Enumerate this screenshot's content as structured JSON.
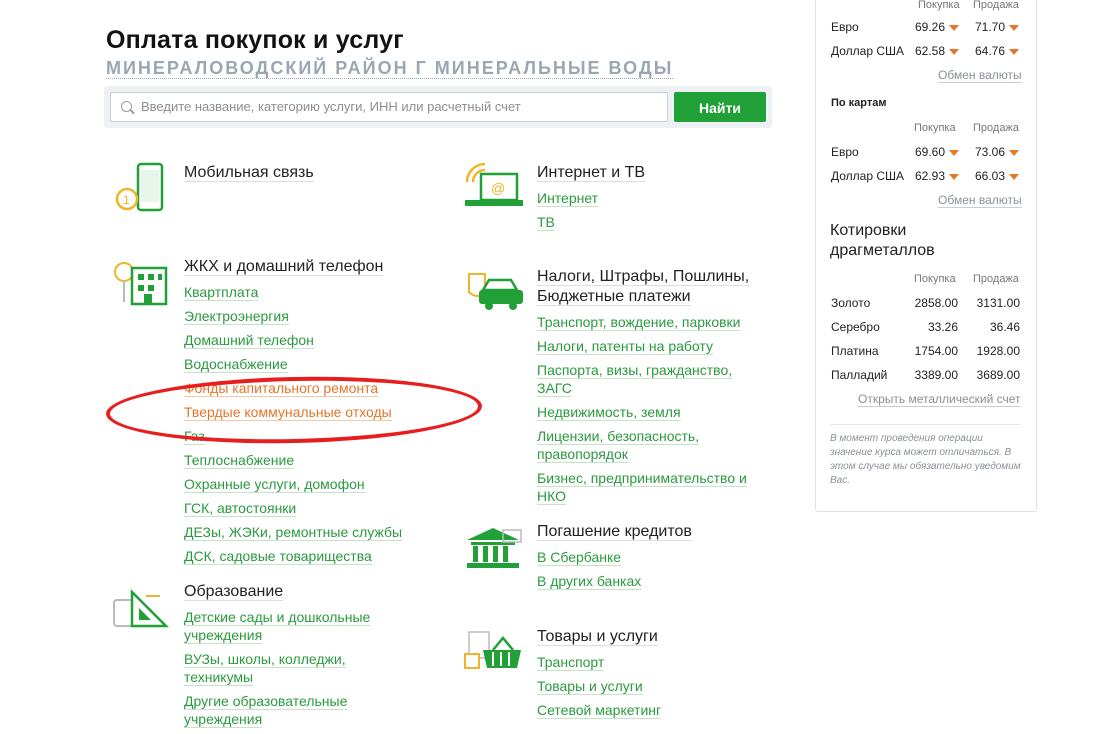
{
  "page": {
    "title": "Оплата покупок и услуг",
    "region": "МИНЕРАЛОВОДСКИЙ РАЙОН Г МИНЕРАЛЬНЫЕ ВОДЫ",
    "search_placeholder": "Введите название, категорию услуги, ИНН или расчетный счет",
    "search_button": "Найти"
  },
  "left_categories": [
    {
      "title": "Мобильная связь",
      "icon": "phone-icon",
      "links": []
    },
    {
      "title": "ЖКХ и домашний телефон",
      "icon": "house-icon",
      "links": [
        "Квартплата",
        "Электроэнергия",
        "Домашний телефон",
        "Водоснабжение",
        "Фонды капитального ремонта",
        "Твердые коммунальные отходы",
        "Газ",
        "Теплоснабжение",
        "Охранные услуги, домофон",
        "ГСК, автостоянки",
        "ДЕЗы, ЖЭКи, ремонтные службы",
        "ДСК, садовые товарищества"
      ]
    },
    {
      "title": "Образование",
      "icon": "education-icon",
      "links": [
        "Детские сады и дошкольные учреждения",
        "ВУЗы, школы, колледжи, техникумы",
        "Другие образовательные учреждения"
      ]
    }
  ],
  "right_categories": [
    {
      "title": "Интернет и ТВ",
      "icon": "laptop-icon",
      "links": [
        "Интернет",
        "ТВ"
      ]
    },
    {
      "title": "Налоги, Штрафы, Пошлины, Бюджетные платежи",
      "icon": "car-icon",
      "links": [
        "Транспорт, вождение, парковки",
        "Налоги, патенты на работу",
        "Паспорта, визы, гражданство, ЗАГС",
        "Недвижимость, земля",
        "Лицензии, безопасность, правопорядок",
        "Бизнес, предпринимательство и НКО"
      ]
    },
    {
      "title": "Погашение кредитов",
      "icon": "bank-icon",
      "links": [
        "В Сбербанке",
        "В других банках"
      ]
    },
    {
      "title": "Товары и услуги",
      "icon": "basket-icon",
      "links": [
        "Транспорт",
        "Товары и услуги",
        "Сетевой маркетинг"
      ]
    }
  ],
  "rates": {
    "col_buy": "Покупка",
    "col_sell": "Продажа",
    "cash": [
      {
        "cur": "Евро",
        "buy": "69.26",
        "sell": "71.70"
      },
      {
        "cur": "Доллар США",
        "buy": "62.58",
        "sell": "64.76"
      }
    ],
    "exchange_link": "Обмен валюты",
    "cards_title": "По картам",
    "cards": [
      {
        "cur": "Евро",
        "buy": "69.60",
        "sell": "73.06"
      },
      {
        "cur": "Доллар США",
        "buy": "62.93",
        "sell": "66.03"
      }
    ],
    "exchange_link2": "Обмен валюты",
    "metals_title": "Котировки драгметаллов",
    "metals": [
      {
        "name": "Золото",
        "buy": "2858.00",
        "sell": "3131.00"
      },
      {
        "name": "Серебро",
        "buy": "33.26",
        "sell": "36.46"
      },
      {
        "name": "Платина",
        "buy": "1754.00",
        "sell": "1928.00"
      },
      {
        "name": "Палладий",
        "buy": "3389.00",
        "sell": "3689.00"
      }
    ],
    "metal_link": "Открыть металлический счет",
    "note": "В момент проведения операции значение курса может отличаться. В этом случае мы обязательно уведомим Вас."
  },
  "colors": {
    "accent": "#21a038",
    "highlight": "#e4762a",
    "annotation": "#e81e1e"
  }
}
